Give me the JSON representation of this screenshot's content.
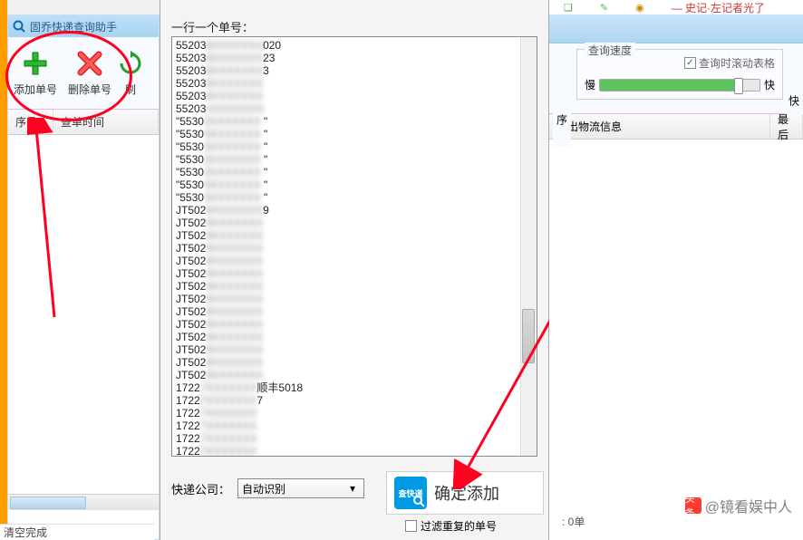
{
  "app": {
    "title": "固乔快递查询助手"
  },
  "toolbar": {
    "add_label": "添加单号",
    "delete_label": "删除单号",
    "refresh_label": "刷"
  },
  "columns": {
    "seq": "序号",
    "time": "查单时间"
  },
  "status": {
    "text": "清空完成"
  },
  "dialog": {
    "label": "一行一个单号：",
    "lines": [
      {
        "p": "55203",
        "b": "8XXXXXXX",
        "s": "020"
      },
      {
        "p": "55203",
        "b": "8XXXXXXX",
        "s": "23"
      },
      {
        "p": "55203",
        "b": "8XXXXXXX",
        "s": "3"
      },
      {
        "p": "55203",
        "b": "8XXXXXXX",
        "s": ""
      },
      {
        "p": "55203",
        "b": "8XXXXXXX",
        "s": ""
      },
      {
        "p": "55203",
        "b": "XXXXXXXX",
        "s": ""
      },
      {
        "p": "\"5530",
        "b": "3XXXXXXX",
        "s": "   \""
      },
      {
        "p": "\"5530",
        "b": "3XXXXXXX",
        "s": "   \""
      },
      {
        "p": "\"5530",
        "b": "3XXXXXXX",
        "s": "   \""
      },
      {
        "p": "\"5530",
        "b": "3XXXXXXX",
        "s": "   \""
      },
      {
        "p": "\"5530",
        "b": "3XXXXXXX",
        "s": "   \""
      },
      {
        "p": "\"5530",
        "b": "3XXXXXXX",
        "s": "   \""
      },
      {
        "p": "\"5530",
        "b": "3XXXXXXX",
        "s": "   \""
      },
      {
        "p": "JT502",
        "b": "9XXXXXXX",
        "s": "9"
      },
      {
        "p": "JT502",
        "b": "9XXXXXXX",
        "s": ""
      },
      {
        "p": "JT502",
        "b": "9XXXXXXX",
        "s": ""
      },
      {
        "p": "JT502",
        "b": "9XXXXXXX",
        "s": ""
      },
      {
        "p": "JT502",
        "b": "9XXXXXXX",
        "s": ""
      },
      {
        "p": "JT502",
        "b": "9XXXXXXX",
        "s": ""
      },
      {
        "p": "JT502",
        "b": "9XXXXXXX",
        "s": ""
      },
      {
        "p": "JT502",
        "b": "9XXXXXXX",
        "s": ""
      },
      {
        "p": "JT502",
        "b": "9XXXXXXX",
        "s": ""
      },
      {
        "p": "JT502",
        "b": "9XXXXXXX",
        "s": ""
      },
      {
        "p": "JT502",
        "b": "9XXXXXXX",
        "s": ""
      },
      {
        "p": "JT502",
        "b": "9XXXXXXX",
        "s": ""
      },
      {
        "p": "JT502",
        "b": "9XXXXXXX",
        "s": ""
      },
      {
        "p": "JT502",
        "b": "9XXXXXXX",
        "s": ""
      },
      {
        "p": "1722",
        "b": "7XXXXXXX",
        "s": "顺丰5018"
      },
      {
        "p": "1722",
        "b": "7XXXXXXX",
        "s": "7"
      },
      {
        "p": "1722",
        "b": "7XXXXXXX",
        "s": ""
      },
      {
        "p": "1722",
        "b": "7XXXXXXX",
        "s": ""
      },
      {
        "p": "1722",
        "b": "7XXXXXXX",
        "s": ""
      },
      {
        "p": "1722",
        "b": "7XXXXXXX",
        "s": ""
      }
    ],
    "company_label": "快递公司：",
    "company_value": "自动识别",
    "filter_label": "过滤重复的单号",
    "confirm_label": "确定添加",
    "confirm_icon_text": "查快递"
  },
  "right": {
    "speed_title": "查询速度",
    "scroll_check": "查询时滚动表格",
    "slow": "慢",
    "fast": "快",
    "left_btn": "序",
    "right_btn_top": "快",
    "right_btn_bot": "最后",
    "col1": "发出物流信息",
    "col2": "最后",
    "status": ": 0单"
  },
  "watermark": {
    "prefix": "头条",
    "text": "@镜看娱中人"
  }
}
